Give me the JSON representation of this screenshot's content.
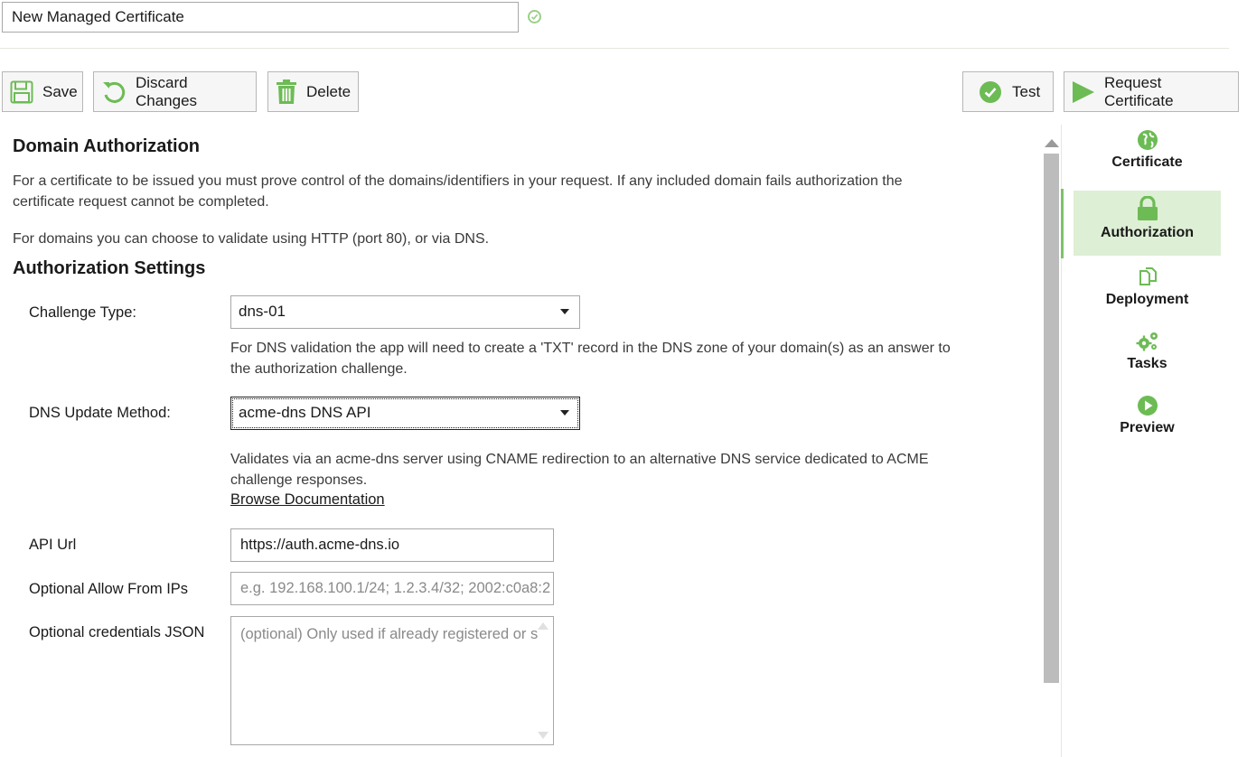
{
  "header": {
    "title_value": "New Managed Certificate"
  },
  "toolbar": {
    "save_label": "Save",
    "discard_label": "Discard Changes",
    "delete_label": "Delete",
    "test_label": "Test",
    "request_label": "Request Certificate"
  },
  "domain_auth": {
    "heading": "Domain Authorization",
    "para1_line1": "For a certificate to be issued you must prove control of the domains/identifiers in your request. If any included domain fails authorization the",
    "para1_line2": "certificate request cannot be completed.",
    "para2": "For domains you can choose to validate using HTTP (port 80), or via DNS."
  },
  "auth_settings": {
    "heading": "Authorization Settings",
    "challenge_type_label": "Challenge Type:",
    "challenge_type_value": "dns-01",
    "challenge_help_line1": "For DNS validation the app will need to create a 'TXT' record in the DNS zone of your domain(s) as an answer to",
    "challenge_help_line2": "the authorization challenge.",
    "dns_method_label": "DNS Update Method:",
    "dns_method_value": "acme-dns DNS API",
    "dns_help_line1": "Validates via an acme-dns server using CNAME redirection to an alternative DNS service dedicated to ACME",
    "dns_help_line2": "challenge responses.",
    "browse_docs_link": "Browse Documentation",
    "api_url_label": "API Url",
    "api_url_value": "https://auth.acme-dns.io",
    "allow_ips_label": "Optional Allow From IPs",
    "allow_ips_placeholder": "e.g.  192.168.100.1/24; 1.2.3.4/32; 2002:c0a8:2",
    "credentials_label": "Optional credentials JSON",
    "credentials_placeholder": "(optional) Only used if already registered or s"
  },
  "nav": {
    "items": [
      {
        "label": "Certificate",
        "icon": "globe-icon"
      },
      {
        "label": "Authorization",
        "icon": "lock-icon"
      },
      {
        "label": "Deployment",
        "icon": "copy-icon"
      },
      {
        "label": "Tasks",
        "icon": "gears-icon"
      },
      {
        "label": "Preview",
        "icon": "play-icon"
      }
    ],
    "active": "Authorization"
  },
  "colors": {
    "accent_green": "#6dbb55",
    "active_nav_bg": "#ddefd4"
  }
}
